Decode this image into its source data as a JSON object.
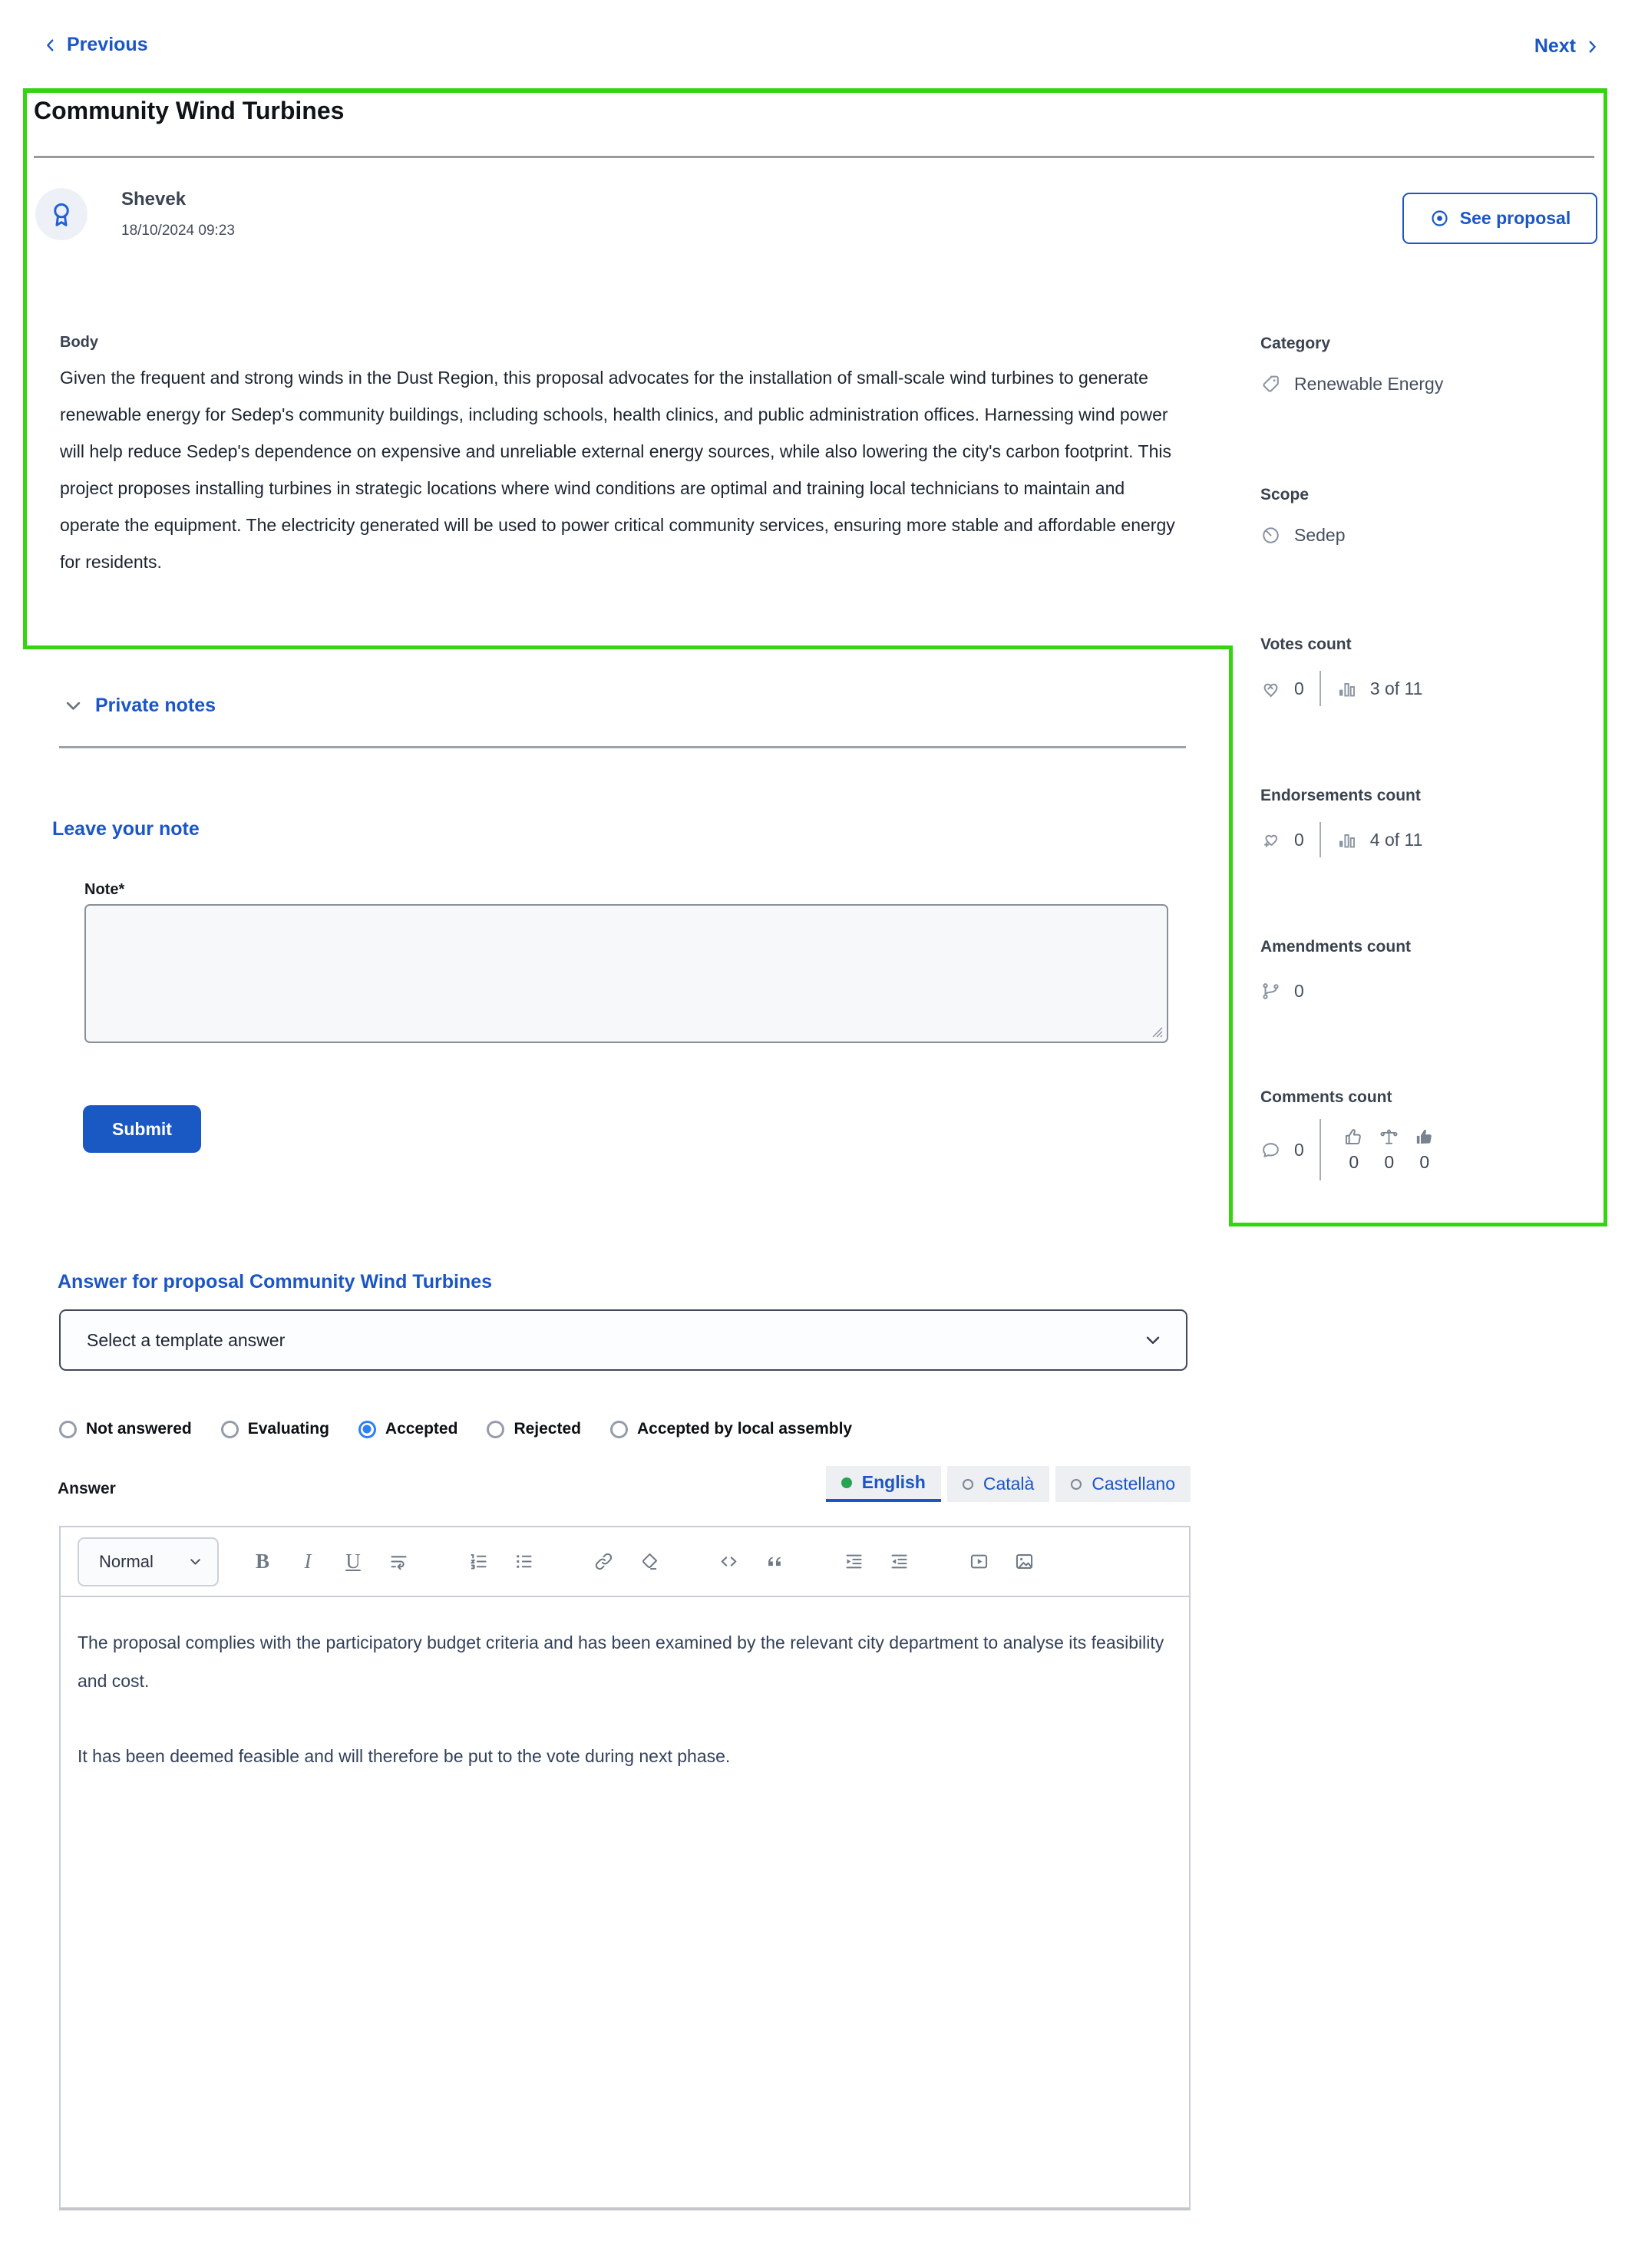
{
  "nav": {
    "previous_label": "Previous",
    "next_label": "Next"
  },
  "annotation": {
    "highlight_color": "#35d411"
  },
  "colors": {
    "primary_blue": "#1a56c5",
    "radio_accent_blue": "#2e7ff2",
    "submit_button_blue": "#1a58c4",
    "language_complete_green": "#27a353",
    "annotation_green": "#35d411"
  },
  "proposal": {
    "title": "Community Wind Turbines",
    "author": {
      "name": "Shevek",
      "date": "18/10/2024 09:23"
    },
    "see_proposal_label": "See proposal",
    "body_label": "Body",
    "body": "Given the frequent and strong winds in the Dust Region, this proposal advocates for the installation of small-scale wind turbines to generate renewable energy for Sedep's community buildings, including schools, health clinics, and public administration offices. Harnessing wind power will help reduce Sedep's dependence on expensive and unreliable external energy sources, while also lowering the city's carbon footprint. This project proposes installing turbines in strategic locations where wind conditions are optimal and training local technicians to maintain and operate the equipment. The electricity generated will be used to power critical community services, ensuring more stable and affordable energy for residents."
  },
  "sidebar": {
    "category": {
      "label": "Category",
      "value": "Renewable Energy"
    },
    "scope": {
      "label": "Scope",
      "value": "Sedep"
    },
    "votes": {
      "label": "Votes count",
      "count": "0",
      "ranking": "3 of 11"
    },
    "endorsements": {
      "label": "Endorsements count",
      "count": "0",
      "ranking": "4 of 11"
    },
    "amendments": {
      "label": "Amendments count",
      "count": "0"
    },
    "comments": {
      "label": "Comments count",
      "count": "0",
      "in_favor": "0",
      "neutral": "0",
      "against": "0"
    }
  },
  "private_notes": {
    "title": "Private notes"
  },
  "note_form": {
    "heading": "Leave your note",
    "note_label": "Note*",
    "note_value": "",
    "submit_label": "Submit"
  },
  "answer_section": {
    "heading": "Answer for proposal Community Wind Turbines",
    "template_select_value": "Select a template answer",
    "statuses": [
      {
        "label": "Not answered",
        "selected": false
      },
      {
        "label": "Evaluating",
        "selected": false
      },
      {
        "label": "Accepted",
        "selected": true
      },
      {
        "label": "Rejected",
        "selected": false
      },
      {
        "label": "Accepted by local assembly",
        "selected": false
      }
    ],
    "answer_label": "Answer",
    "languages": [
      {
        "label": "English",
        "status": "complete",
        "active": true
      },
      {
        "label": "Català",
        "status": "empty",
        "active": false
      },
      {
        "label": "Castellano",
        "status": "empty",
        "active": false
      }
    ],
    "editor": {
      "format_select_value": "Normal",
      "toolbar_icons": [
        "bold-icon",
        "italic-icon",
        "underline-icon",
        "text-wrap-icon",
        "ordered-list-icon",
        "unordered-list-icon",
        "link-icon",
        "format-clear-icon",
        "code-icon",
        "quote-icon",
        "indent-increase-icon",
        "indent-decrease-icon",
        "video-icon",
        "image-icon"
      ],
      "paragraphs": [
        "The proposal complies with the participatory budget criteria and has been examined by the relevant city department to analyse its feasibility and cost.",
        "It has been deemed feasible and will therefore be put to the vote during next phase."
      ]
    }
  }
}
